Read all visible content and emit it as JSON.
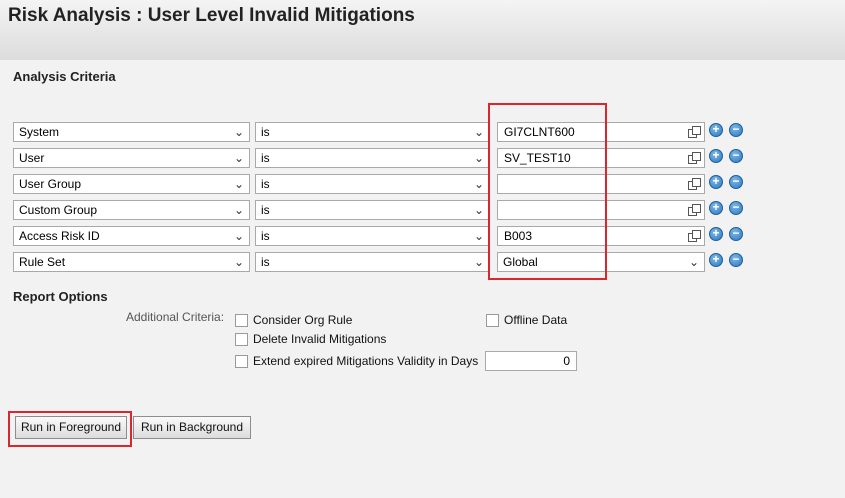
{
  "header": {
    "title": "Risk Analysis : User Level Invalid Mitigations"
  },
  "analysis": {
    "section_title": "Analysis Criteria",
    "rows": [
      {
        "field": "System",
        "operator": "is",
        "value": "GI7CLNT600",
        "value_type": "input"
      },
      {
        "field": "User",
        "operator": "is",
        "value": "SV_TEST10",
        "value_type": "input"
      },
      {
        "field": "User Group",
        "operator": "is",
        "value": "",
        "value_type": "input"
      },
      {
        "field": "Custom Group",
        "operator": "is",
        "value": "",
        "value_type": "input"
      },
      {
        "field": "Access Risk ID",
        "operator": "is",
        "value": "B003",
        "value_type": "input"
      },
      {
        "field": "Rule Set",
        "operator": "is",
        "value": "Global",
        "value_type": "select"
      }
    ],
    "add_glyph": "+",
    "remove_glyph": "−",
    "icons": {
      "value_help": "copy-icon",
      "add": "add-icon",
      "remove": "remove-icon"
    }
  },
  "report": {
    "section_title": "Report Options",
    "additional_label": "Additional Criteria:",
    "consider_org_rule": "Consider Org Rule",
    "offline_data": "Offline Data",
    "delete_invalid": "Delete Invalid Mitigations",
    "extend_expired": "Extend expired Mitigations Validity in Days",
    "days_value": "0"
  },
  "buttons": {
    "foreground": "Run in Foreground",
    "background": "Run in Background"
  },
  "colors": {
    "highlight": "#d9262f",
    "round_button": "#2a78c2"
  }
}
